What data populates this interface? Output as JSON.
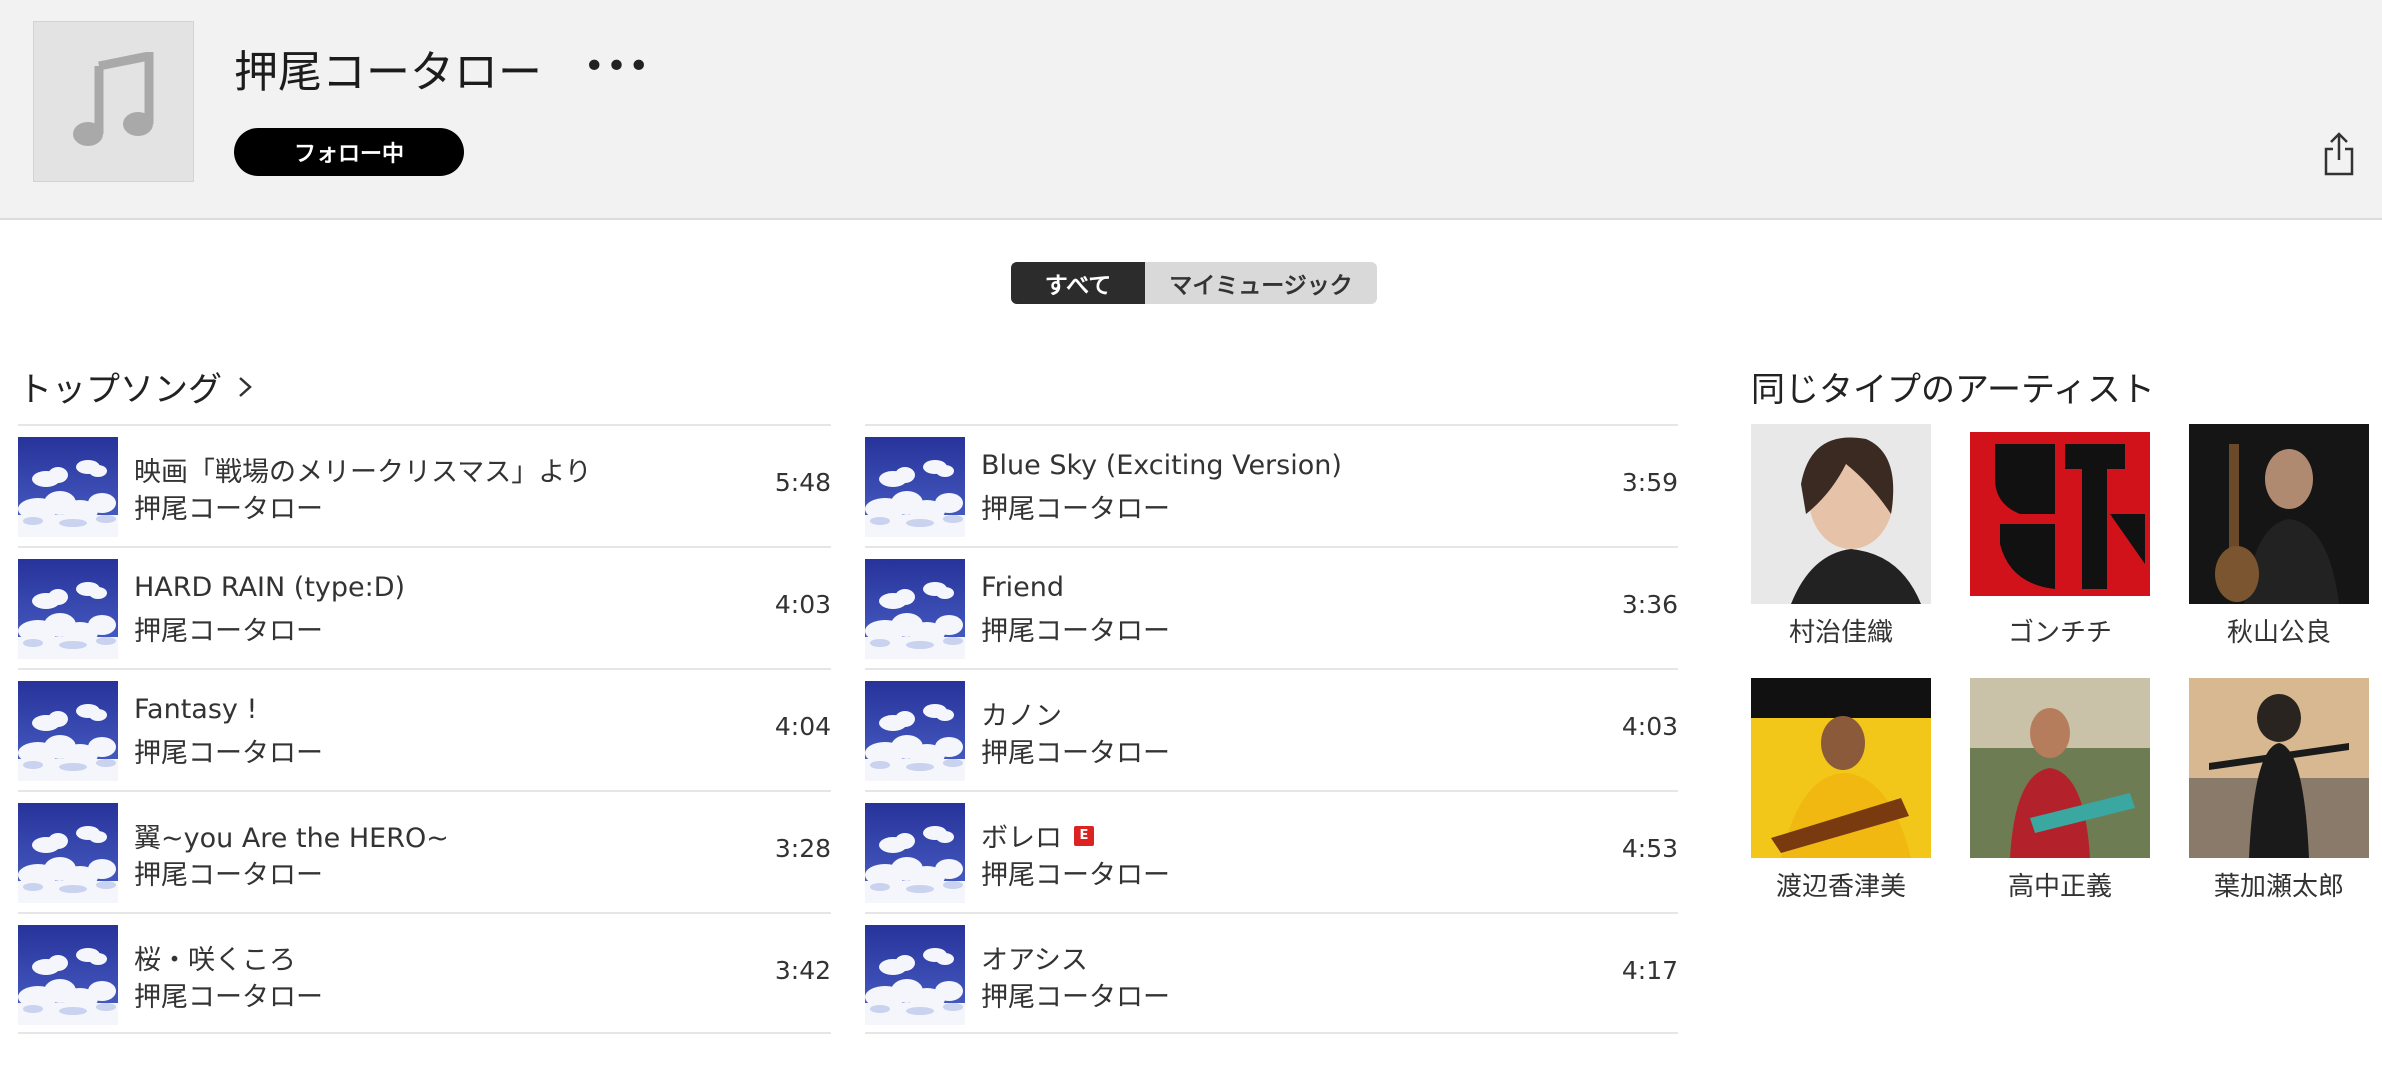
{
  "header": {
    "artist_name": "押尾コータロー",
    "more_glyph": "•••",
    "follow_label": "フォロー中",
    "artwork_icon": "music-note-icon",
    "share_icon": "share-icon"
  },
  "filter": {
    "all_label": "すべて",
    "my_music_label": "マイミュージック",
    "selected": "すべて"
  },
  "top_songs": {
    "title": "トップソング",
    "left": [
      {
        "title": "映画「戦場のメリークリスマス」より",
        "artist": "押尾コータロー",
        "duration": "5:48",
        "explicit": false
      },
      {
        "title": "HARD RAIN (type:D)",
        "artist": "押尾コータロー",
        "duration": "4:03",
        "explicit": false
      },
      {
        "title": "Fantasy !",
        "artist": "押尾コータロー",
        "duration": "4:04",
        "explicit": false
      },
      {
        "title": "翼~you Are the HERO~",
        "artist": "押尾コータロー",
        "duration": "3:28",
        "explicit": false
      },
      {
        "title": "桜・咲くころ",
        "artist": "押尾コータロー",
        "duration": "3:42",
        "explicit": false
      }
    ],
    "right": [
      {
        "title": "Blue Sky (Exciting Version)",
        "artist": "押尾コータロー",
        "duration": "3:59",
        "explicit": false
      },
      {
        "title": "Friend",
        "artist": "押尾コータロー",
        "duration": "3:36",
        "explicit": false
      },
      {
        "title": "カノン",
        "artist": "押尾コータロー",
        "duration": "4:03",
        "explicit": false
      },
      {
        "title": "ボレロ",
        "artist": "押尾コータロー",
        "duration": "4:53",
        "explicit": true
      },
      {
        "title": "オアシス",
        "artist": "押尾コータロー",
        "duration": "4:17",
        "explicit": false
      }
    ],
    "explicit_badge": "E"
  },
  "similar_artists": {
    "title": "同じタイプのアーティスト",
    "items": [
      {
        "name": "村治佳織"
      },
      {
        "name": "ゴンチチ"
      },
      {
        "name": "秋山公良"
      },
      {
        "name": "渡辺香津美"
      },
      {
        "name": "高中正義"
      },
      {
        "name": "葉加瀬太郎"
      }
    ]
  },
  "colors": {
    "header_bg": "#f2f2f2",
    "follow_bg": "#000000",
    "segment_active": "#2c2c2c",
    "segment_inactive": "#d9d9d9",
    "explicit_red": "#dd2222"
  }
}
